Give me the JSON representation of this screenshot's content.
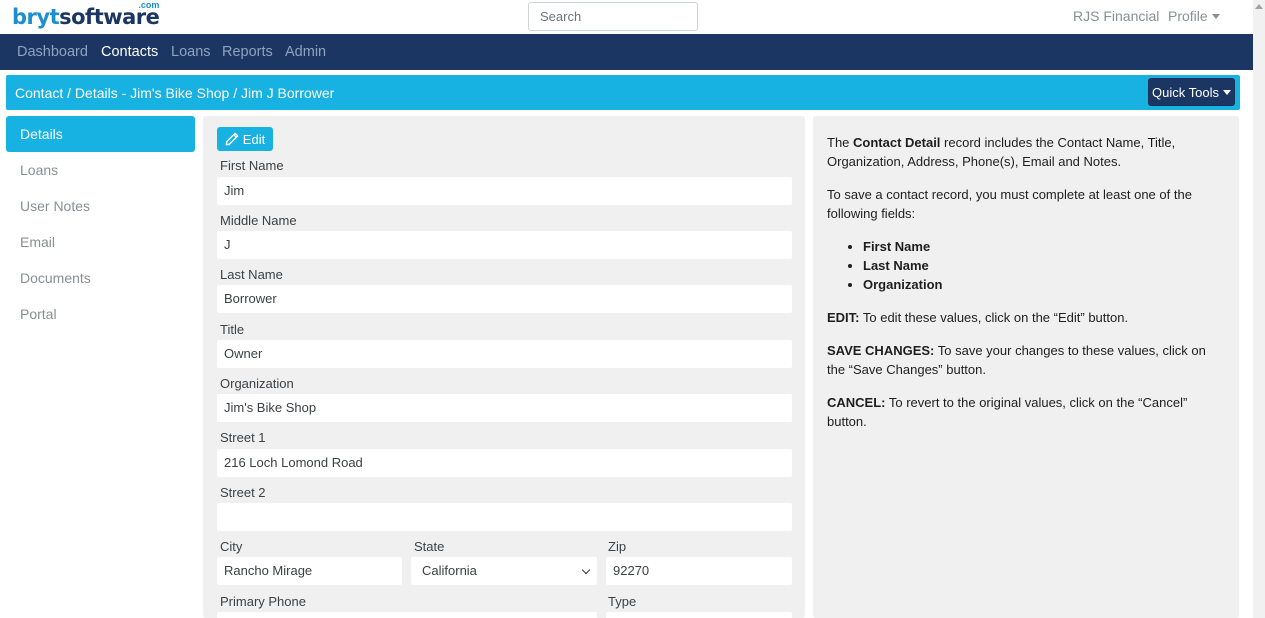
{
  "brand": {
    "part1": "bryt",
    "part2": "software",
    "suffix": ".com"
  },
  "search": {
    "placeholder": "Search"
  },
  "user": {
    "org": "RJS Financial",
    "profile_label": "Profile"
  },
  "nav": [
    {
      "label": "Dashboard"
    },
    {
      "label": "Contacts"
    },
    {
      "label": "Loans"
    },
    {
      "label": "Reports"
    },
    {
      "label": "Admin"
    }
  ],
  "page": {
    "breadcrumb": "Contact / Details - Jim's Bike Shop / Jim J Borrower",
    "quick_tools_label": "Quick Tools"
  },
  "sidebar": [
    {
      "label": "Details"
    },
    {
      "label": "Loans"
    },
    {
      "label": "User Notes"
    },
    {
      "label": "Email"
    },
    {
      "label": "Documents"
    },
    {
      "label": "Portal"
    }
  ],
  "form": {
    "edit_label": "Edit",
    "first_name": {
      "label": "First Name",
      "value": "Jim"
    },
    "middle_name": {
      "label": "Middle Name",
      "value": "J"
    },
    "last_name": {
      "label": "Last Name",
      "value": "Borrower"
    },
    "title": {
      "label": "Title",
      "value": "Owner"
    },
    "organization": {
      "label": "Organization",
      "value": "Jim's Bike Shop"
    },
    "street1": {
      "label": "Street 1",
      "value": "216 Loch Lomond Road"
    },
    "street2": {
      "label": "Street 2",
      "value": ""
    },
    "city": {
      "label": "City",
      "value": "Rancho Mirage"
    },
    "state": {
      "label": "State",
      "value": "California"
    },
    "zip": {
      "label": "Zip",
      "value": "92270"
    },
    "primary_phone": {
      "label": "Primary Phone",
      "value": ""
    },
    "type": {
      "label": "Type",
      "value": ""
    }
  },
  "help": {
    "intro_pre": "The ",
    "intro_bold": "Contact Detail",
    "intro_post": " record includes the Contact Name, Title, Organization, Address, Phone(s), Email and Notes.",
    "save_rule": "To save a contact record, you must complete at least one of the following fields:",
    "required_fields": [
      "First Name",
      "Last Name",
      "Organization"
    ],
    "edit_bold": "EDIT:",
    "edit_text": " To edit these values, click on the “Edit” button.",
    "save_bold": "SAVE CHANGES:",
    "save_text": " To save your changes to these values, click on the “Save Changes” button.",
    "cancel_bold": "CANCEL:",
    "cancel_text": " To revert to the original values, click on the “Cancel” button."
  },
  "colors": {
    "accent": "#17b1e2",
    "navy": "#1c3664",
    "panel": "#f0f0f0"
  }
}
